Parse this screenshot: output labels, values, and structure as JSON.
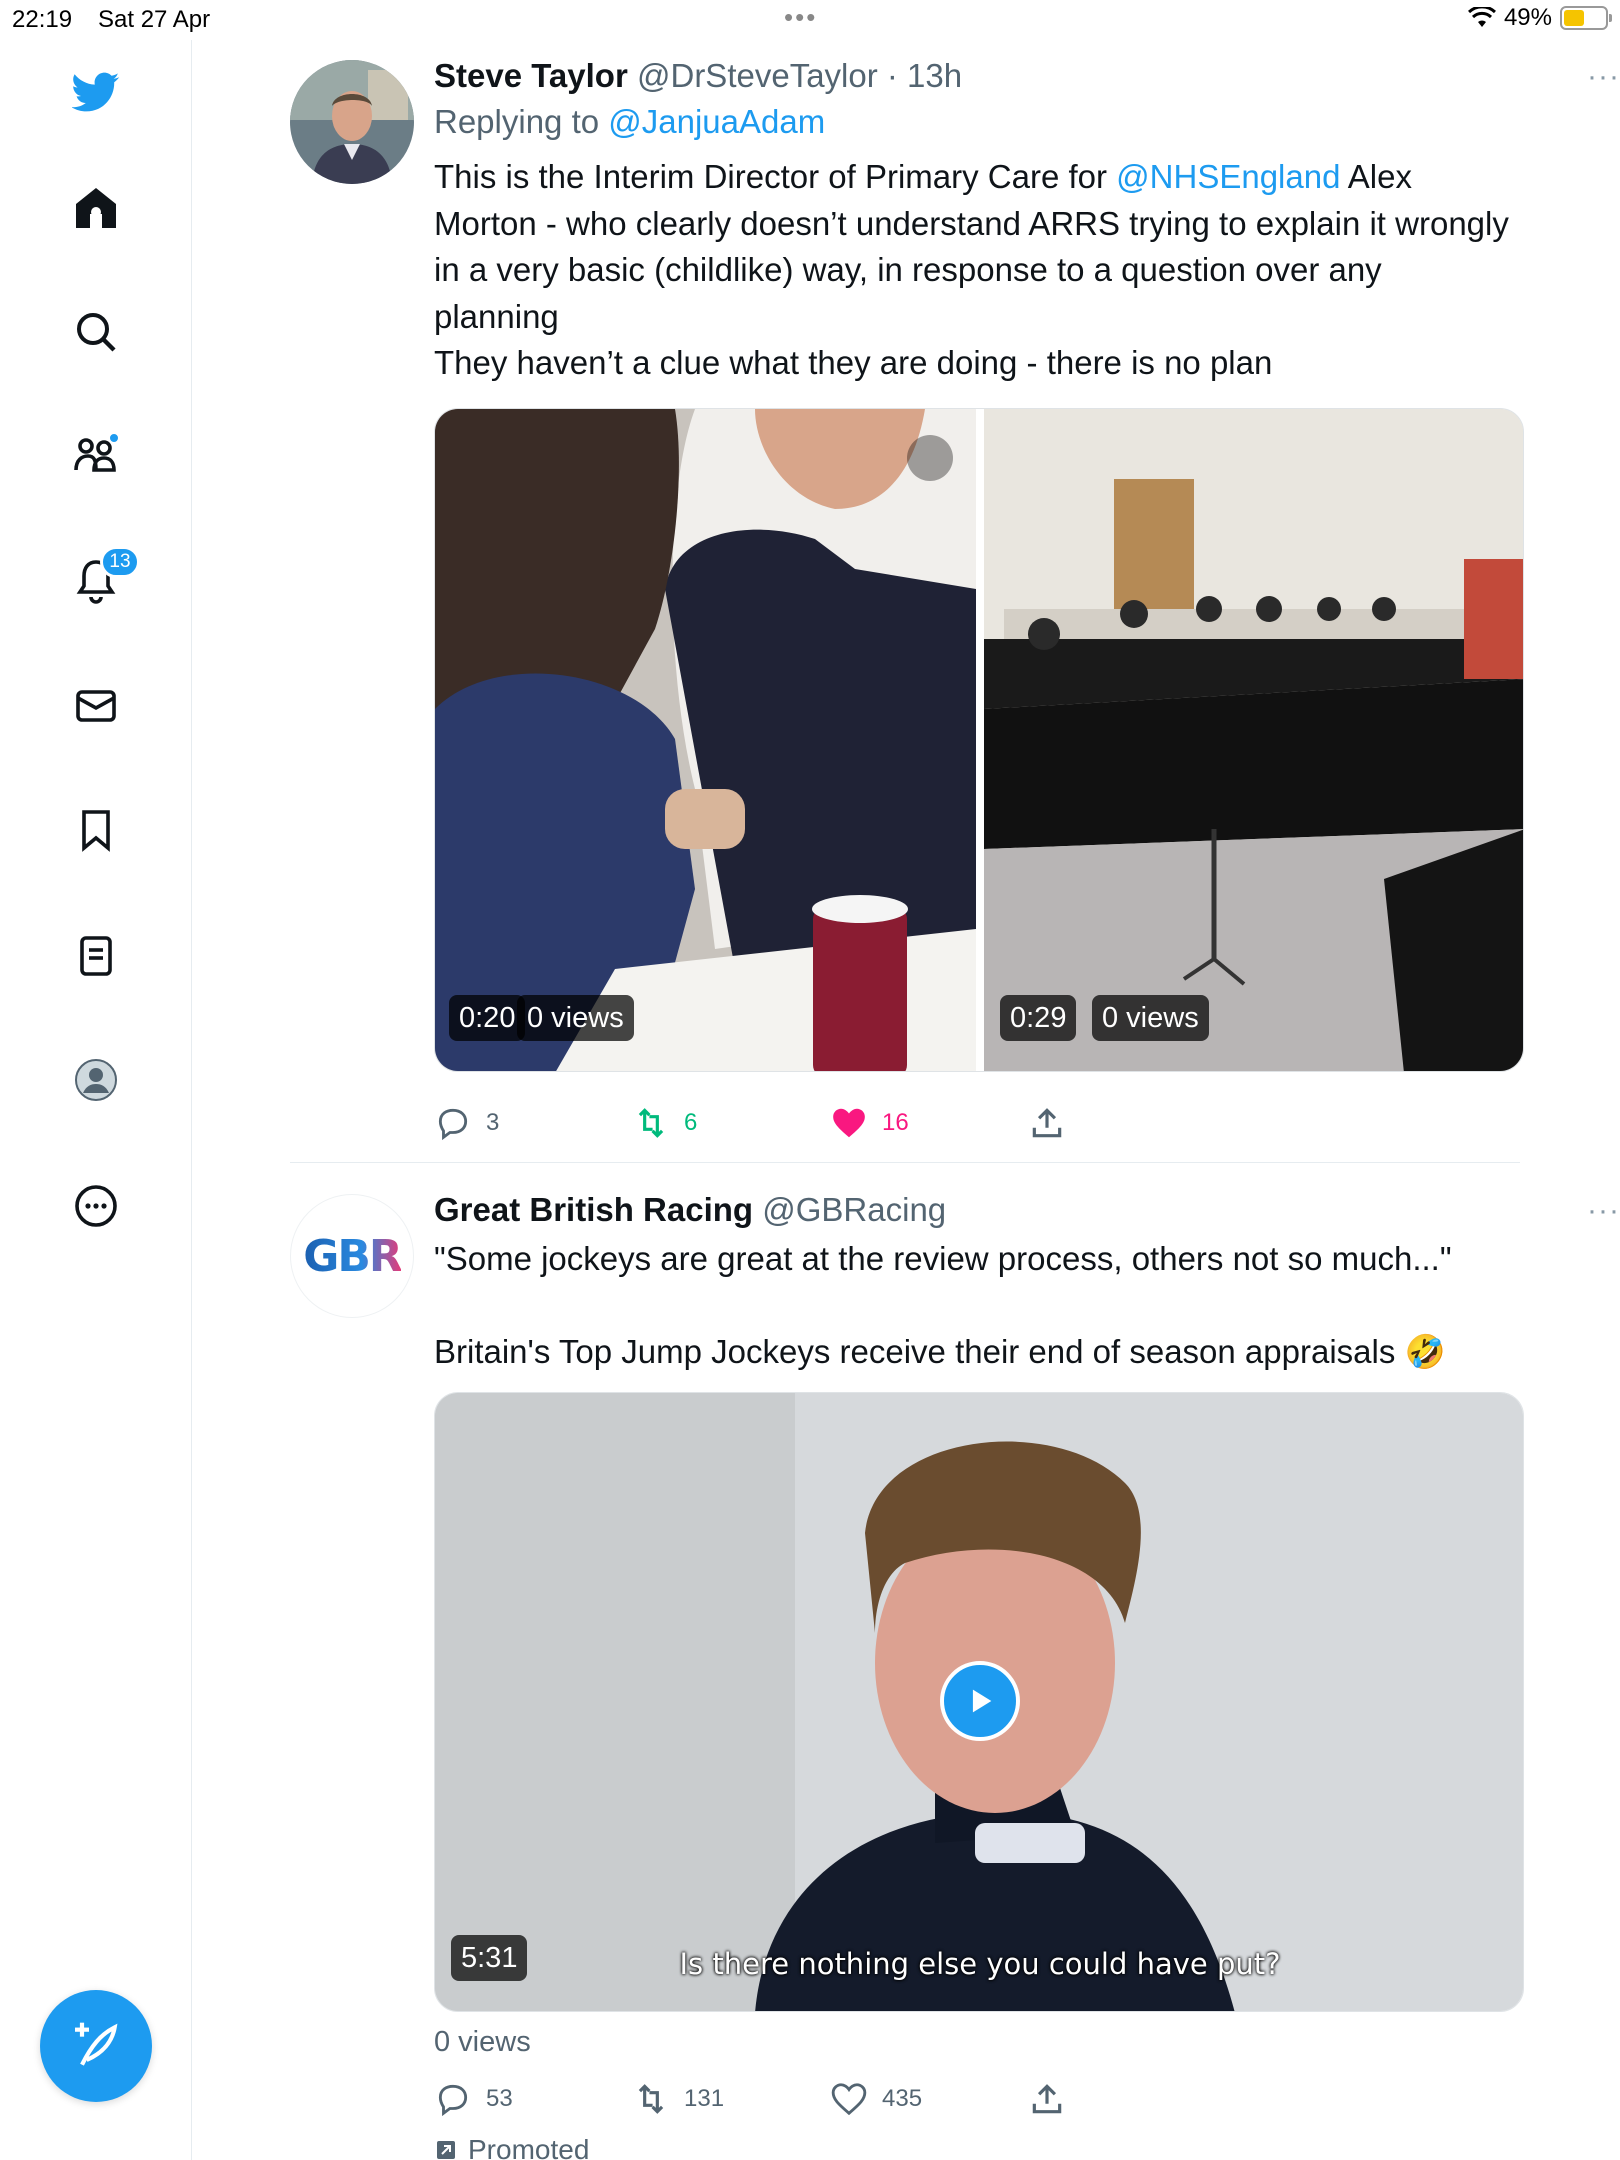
{
  "status_bar": {
    "time": "22:19",
    "date": "Sat 27 Apr",
    "battery": "49%",
    "battery_level": 0.49
  },
  "sidebar": {
    "notifications_count": "13",
    "items": [
      "home",
      "explore",
      "communities",
      "notifications",
      "messages",
      "bookmarks",
      "lists",
      "profile",
      "more"
    ]
  },
  "tweets": [
    {
      "name": "Steve Taylor",
      "handle": "@DrSteveTaylor",
      "time": "· 13h",
      "more": "···",
      "replying_prefix": "Replying to ",
      "replying_to": "@JanjuaAdam",
      "text_before_link": "This is the Interim Director of Primary Care for ",
      "mention": "@NHSEngland",
      "text_after_link": " Alex Morton - who clearly doesn’t understand ARRS trying to explain it wrongly in a very basic (childlike) way, in response to a question over any planning",
      "text_line2": "They haven’t a clue what they are doing - there is no plan",
      "media": [
        {
          "duration": "0:20",
          "views": "0 views"
        },
        {
          "duration": "0:29",
          "views": "0 views"
        }
      ],
      "replies": "3",
      "retweets": "6",
      "likes": "16"
    },
    {
      "name": "Great British Racing",
      "handle": "@GBRacing",
      "more": "···",
      "logo": "GBR",
      "text_line1": "\"Some jockeys are great at the review process, others not so much...\"",
      "text_line2": "Britain's Top Jump Jockeys receive their end of season appraisals 🤣",
      "video_duration": "5:31",
      "subtitle": "Is there nothing else you could have put?",
      "views": "0 views",
      "replies": "53",
      "retweets": "131",
      "likes": "435",
      "promoted": "Promoted"
    }
  ],
  "colors": {
    "accent": "#1d9bf0",
    "like": "#f91880",
    "retweet": "#00ba7c"
  }
}
